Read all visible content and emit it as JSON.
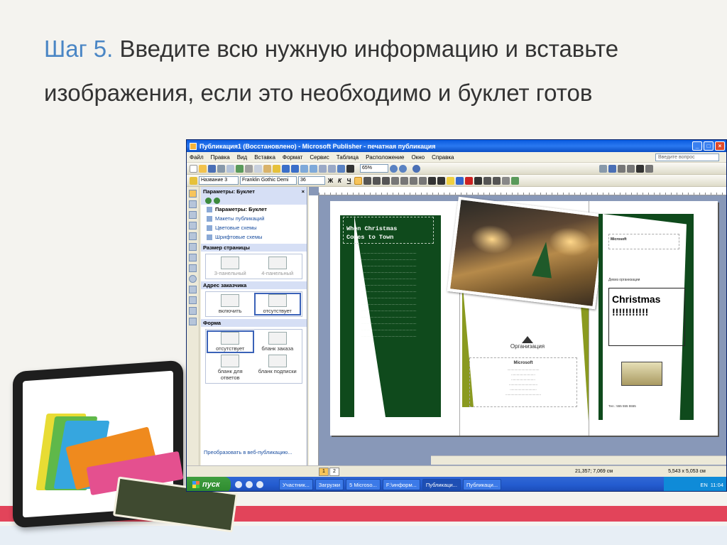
{
  "slide": {
    "step": "Шаг 5.",
    "text": " Введите всю нужную информацию и вставьте изображения, если это необходимо и буклет готов"
  },
  "window": {
    "title": "Публикация1 (Восстановлено) - Microsoft Publisher - печатная публикация",
    "minimize": "_",
    "maximize": "□",
    "close": "×"
  },
  "menubar": {
    "items": [
      "Файл",
      "Правка",
      "Вид",
      "Вставка",
      "Формат",
      "Сервис",
      "Таблица",
      "Расположение",
      "Окно",
      "Справка"
    ],
    "help_placeholder": "Введите вопрос"
  },
  "toolbar": {
    "zoom": "65%",
    "style": "Название 3",
    "font": "Franklin Gothic Demi",
    "size": "36",
    "bold": "Ж",
    "italic": "К",
    "underline": "Ч"
  },
  "taskpane": {
    "title": "Параметры: Буклет",
    "close": "×",
    "links": [
      "Параметры: Буклет",
      "Макеты публикаций",
      "Цветовые схемы",
      "Шрифтовые схемы"
    ],
    "page_size_label": "Размер страницы",
    "page_size_options": [
      "3-панельный",
      "4-панельный"
    ],
    "address_label": "Адрес заказчика",
    "address_options": [
      "включить",
      "отсутствует"
    ],
    "form_label": "Форма",
    "form_options": [
      "отсутствует",
      "бланк заказа",
      "бланк для ответов",
      "бланк подписки"
    ],
    "footer_link": "Преобразовать в веб-публикацию..."
  },
  "brochure": {
    "left_heading_line1": "When Christmas",
    "left_heading_line2": "Comes to Town",
    "org_name": "Организация",
    "company": "Microsoft",
    "right_company": "Microsoft",
    "tagline": "Девиз организации",
    "title": "Christmas !!!!!!!!!!!",
    "phone_line": "Тел.: 555 555 5555"
  },
  "statusbar": {
    "page1": "1",
    "page2": "2",
    "position": "21,357; 7,069 см",
    "size": "5,543 x 5,053 см"
  },
  "taskbar": {
    "start": "пуск",
    "buttons": [
      "Участник...",
      "Загрузки",
      "5 Microso...",
      "F:\\информ...",
      "Публикаци...",
      "Публикаци..."
    ],
    "lang": "EN",
    "time": "11:04"
  }
}
